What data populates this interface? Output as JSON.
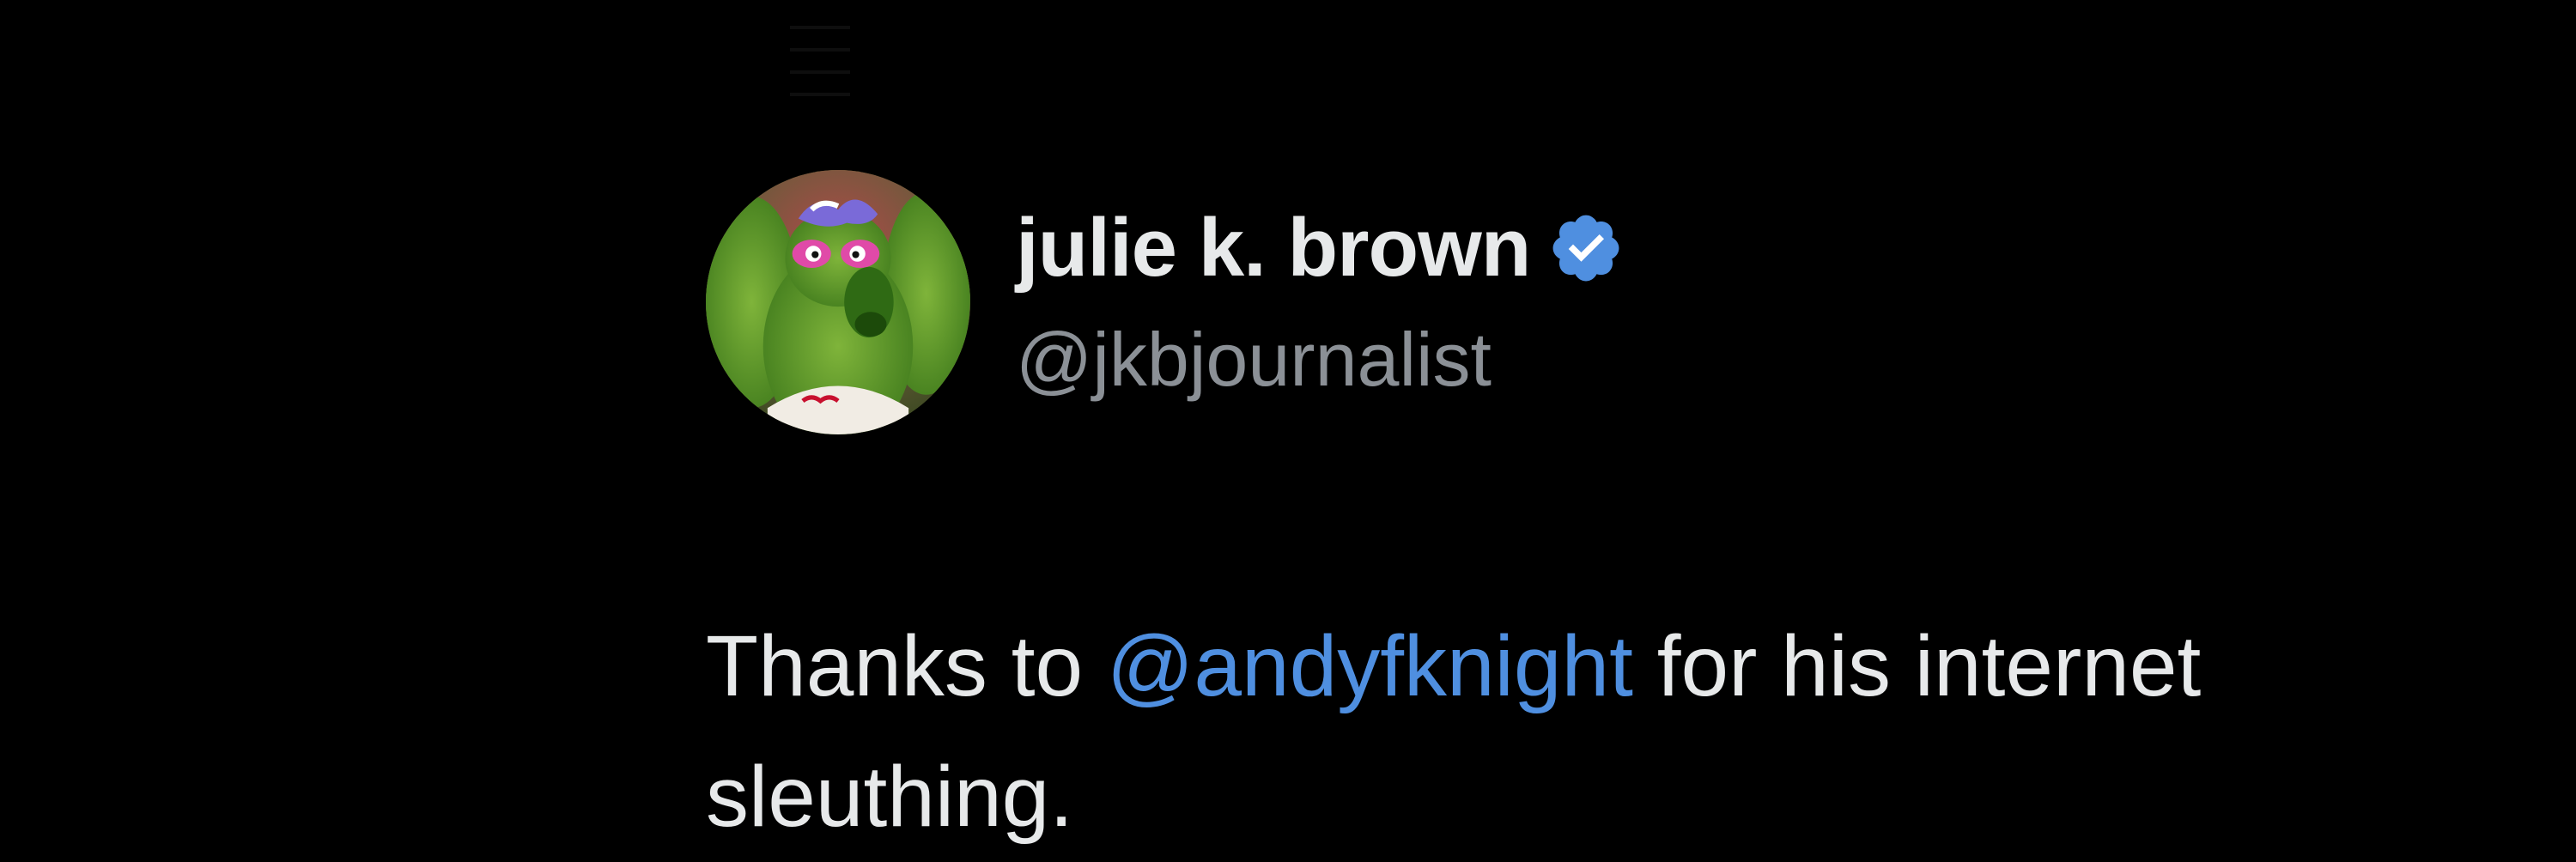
{
  "tweet": {
    "author": {
      "display_name": "julie k. brown",
      "handle": "@jkbjournalist",
      "verified": true,
      "avatar_icon": "mascot-avatar-icon"
    },
    "text": {
      "before_mention": "Thanks to ",
      "mention": "@andyfknight",
      "after_mention": " for his internet sleuthing."
    }
  },
  "colors": {
    "background": "#000000",
    "primary_text": "#e7e9ea",
    "secondary_text": "#8b9096",
    "mention": "#4f8fe0",
    "verified_badge": "#4f8fe0"
  }
}
